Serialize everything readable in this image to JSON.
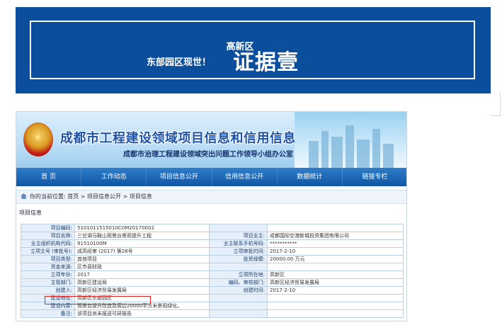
{
  "banner": {
    "line1": "高新区",
    "line2": "东部园区现世！",
    "big": "证据壹"
  },
  "site": {
    "title": "成都市工程建设领域项目信息和信用信息公开共享专栏",
    "subtitle": "成都市治理工程建设领域突出问题工作领导小组办公室"
  },
  "nav": [
    "首 页",
    "工作动态",
    "项目信息公开",
    "信用信息公开",
    "数据统计",
    "链接专栏"
  ],
  "breadcrumb": "你的当前位置: 首页 > 项目信息公开 > 项目信息",
  "section_label": "项目信息",
  "rows": [
    {
      "l1": "项目编码:",
      "v1": "5101011515010C0M20170002",
      "l2": "",
      "v2": ""
    },
    {
      "l1": "项目名称:",
      "v1": "三岔湖马鞍山观景台景观提升工程",
      "l2": "项目业主:",
      "v2": "成都国际空港新城投资集团有限公司"
    },
    {
      "l1": "业主组织机构代码:",
      "v1": "91510100M",
      "l2": "业主联系手机号码:",
      "v2": "***********"
    },
    {
      "l1": "立项文号 (审批号):",
      "v1": "成高经审 (2017) 第28号",
      "l2": "立项审批时间:",
      "v2": "2017-2-10"
    },
    {
      "l1": "项目类型:",
      "v1": "其他项目",
      "l2": "投资规模:",
      "v2": "20000.00 万元"
    },
    {
      "l1": "资金来源:",
      "v1": "区市县财政",
      "l2": "",
      "v2": ""
    },
    {
      "l1": "立项年份:",
      "v1": "2017",
      "l2": "立项所在地:",
      "v2": "高新区"
    },
    {
      "l1": "主管部门:",
      "v1": "高新区建设局",
      "l2": "编码、审核部门:",
      "v2": "高新区经济贸易发展局"
    },
    {
      "l1": "创建人:",
      "v1": "高新区经济贸易发展局",
      "l2": "创建时间:",
      "v2": "2017-2-10"
    },
    {
      "l1": "建设地址:",
      "v1": "高新区东部园区",
      "l2": "",
      "v2": ""
    },
    {
      "l1": "建设内容:",
      "v1": "观景台提升改造及周边20000平方米景观绿化。",
      "l2": "",
      "v2": ""
    },
    {
      "l1": "备注:",
      "v1": "该项目尚未报送可研报告",
      "l2": "",
      "v2": ""
    }
  ]
}
